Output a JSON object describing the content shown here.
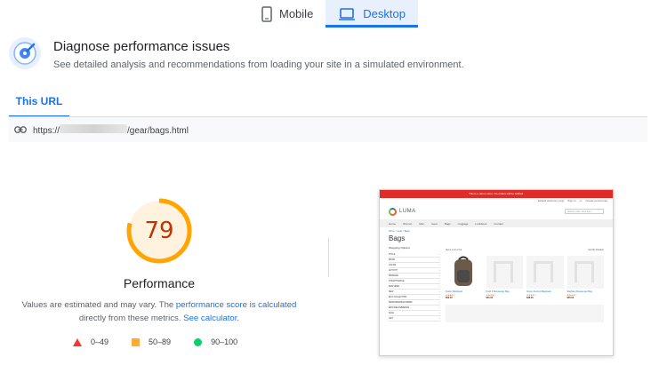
{
  "device_tabs": [
    {
      "label": "Mobile",
      "icon": "smartphone-icon",
      "active": false
    },
    {
      "label": "Desktop",
      "icon": "laptop-icon",
      "active": true
    }
  ],
  "diagnose": {
    "title": "Diagnose performance issues",
    "subtitle": "See detailed analysis and recommendations from loading your site in a simulated environment."
  },
  "url_tab": {
    "label": "This URL"
  },
  "url_bar": {
    "prefix": "https://",
    "suffix": "/gear/bags.html",
    "icon": "link-icon"
  },
  "score": {
    "value": 79,
    "fraction": 0.79,
    "label": "Performance",
    "color": "#ffa400",
    "text_color": "#c33300",
    "note_before": "Values are estimated and may vary. The ",
    "note_link1": "performance score is calculated",
    "note_middle": " directly from these metrics. ",
    "note_link2": "See calculator."
  },
  "legend": [
    {
      "shape": "triangle",
      "range": "0–49",
      "color": "#ff3333"
    },
    {
      "shape": "square",
      "range": "50–89",
      "color": "#ffaa33"
    },
    {
      "shape": "circle",
      "range": "90–100",
      "color": "#0cce6b"
    }
  ],
  "thumbnail": {
    "banner": "This is a demo store. No orders will be fulfilled.",
    "top_links": [
      "Default welcome msg!",
      "Sign In",
      "or",
      "Create an Account"
    ],
    "logo": "LUMA",
    "search_placeholder": "Search entire store here...",
    "nav": [
      "Home",
      "Women",
      "Men",
      "Gear",
      "Bags",
      "Luggage",
      "Lookbook",
      "Contact"
    ],
    "crumb": "Home > Gear > Bags",
    "title": "Bags",
    "side_heading": "Shopping Options",
    "side_filters": [
      "STYLE",
      "PRICE",
      "COLOR",
      "ACTIVITY",
      "MATERIAL",
      "STRAP/HANDLE",
      "FEATURES",
      "NEW",
      "ECO COLLECTION",
      "PERFORMANCE FABRIC",
      "ERIN RECOMMENDS",
      "SALE",
      "GIFT"
    ],
    "toolbar_left": "Items 1-12 of 14",
    "toolbar_right": "Sort By  Position",
    "products": [
      {
        "name": "Fusion Backpack",
        "price": "$59.00"
      },
      {
        "name": "Push It Messenger Bag",
        "price": "$45.00"
      },
      {
        "name": "Crown Summit Backpack",
        "price": "$38.00"
      },
      {
        "name": "Wayfarer Messenger Bag",
        "price": "$45.00"
      }
    ]
  }
}
